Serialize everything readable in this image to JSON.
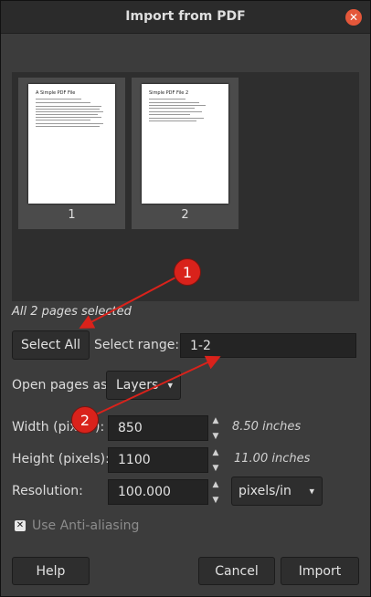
{
  "dialog": {
    "title": "Import from PDF"
  },
  "pages": [
    {
      "number": "1",
      "doc_title": "A Simple PDF File"
    },
    {
      "number": "2",
      "doc_title": "Simple PDF File 2"
    }
  ],
  "selection": {
    "status": "All 2 pages selected",
    "select_all_label": "Select All",
    "range_label": "Select range:",
    "range_value": "1-2"
  },
  "open_as": {
    "label": "Open pages as",
    "value": "Layers"
  },
  "width": {
    "label": "Width (pixels):",
    "value": "850",
    "inches": "8.50 inches"
  },
  "height": {
    "label": "Height (pixels):",
    "value": "1100",
    "inches": "11.00 inches"
  },
  "resolution": {
    "label": "Resolution:",
    "value": "100.000",
    "unit": "pixels/in"
  },
  "antialias": {
    "label": "Use Anti-aliasing",
    "checked": true
  },
  "buttons": {
    "help": "Help",
    "cancel": "Cancel",
    "import": "Import"
  },
  "annotations": [
    {
      "number": "1"
    },
    {
      "number": "2"
    }
  ],
  "colors": {
    "accent": "#e4573a",
    "annotation": "#d9221b"
  }
}
